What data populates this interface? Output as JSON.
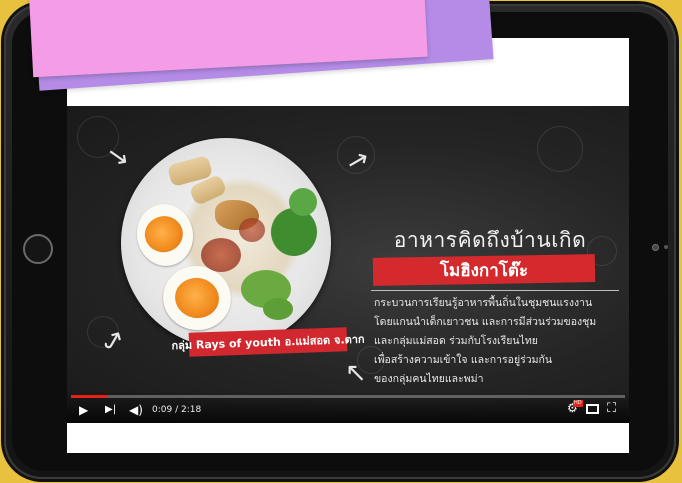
{
  "colors": {
    "background": "#e8c23e",
    "note_pink": "#f59ce6",
    "note_purple": "#b48be6",
    "accent_red": "#d42a2d",
    "progress_red": "#e62117"
  },
  "video": {
    "title_line1": "อาหารคิดถึงบ้านเกิด",
    "title_line2": "โมฮิงกาโต๊ะ",
    "description_lines": [
      "กระบวนการเรียนรู้อาหารพื้นถิ่นในชุมชนแรงงาน",
      "โดยแกนนำเด็กเยาวชน และการมีส่วนร่วมของชุม",
      "และกลุ่มแม่สอด ร่วมกับโรงเรียนไทย",
      "เพื่อสร้างความเข้าใจ และการอยู่ร่วมกัน",
      "ของกลุ่มคนไทยและพม่า"
    ],
    "tag_label": "กลุ่ม Rays of youth อ.แม่สอด จ.ตาก"
  },
  "player": {
    "current_time": "0:09",
    "duration": "2:18",
    "time_display": "0:09 / 2:18",
    "progress_fraction": 0.065,
    "hd_badge": "HD",
    "icons": [
      "play-icon",
      "next-icon",
      "volume-icon",
      "settings-icon",
      "miniplayer-icon",
      "fullscreen-icon"
    ]
  }
}
